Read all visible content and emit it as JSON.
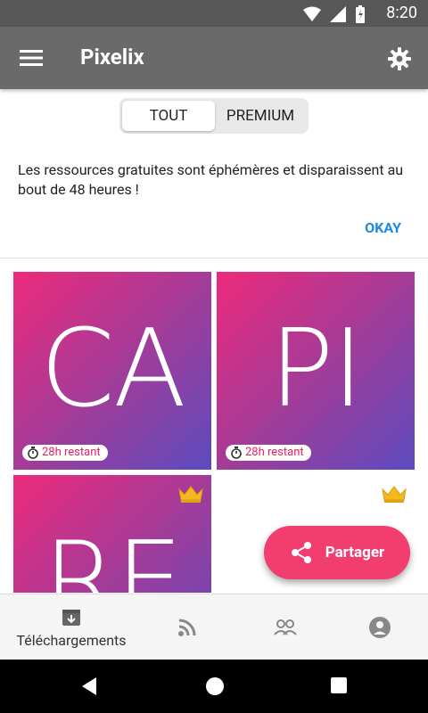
{
  "status": {
    "time": "8:20"
  },
  "app": {
    "title": "Pixelix"
  },
  "tabs": {
    "all": "TOUT",
    "premium": "PREMIUM"
  },
  "notice": {
    "text": "Les ressources gratuites sont éphémères et disparaissent au bout de 48 heures !",
    "ok": "OKAY"
  },
  "cards": [
    {
      "text": "CA",
      "remaining": "28h restant"
    },
    {
      "text": "PI",
      "remaining": "28h restant"
    },
    {
      "text": "RE"
    }
  ],
  "fab": {
    "label": "Partager"
  },
  "bottom_nav": {
    "downloads": "Téléchargements"
  },
  "colors": {
    "accent": "#f23d6f",
    "link": "#1e88e5",
    "gradient_start": "#ed2a7b",
    "gradient_end": "#5c4bbf"
  }
}
